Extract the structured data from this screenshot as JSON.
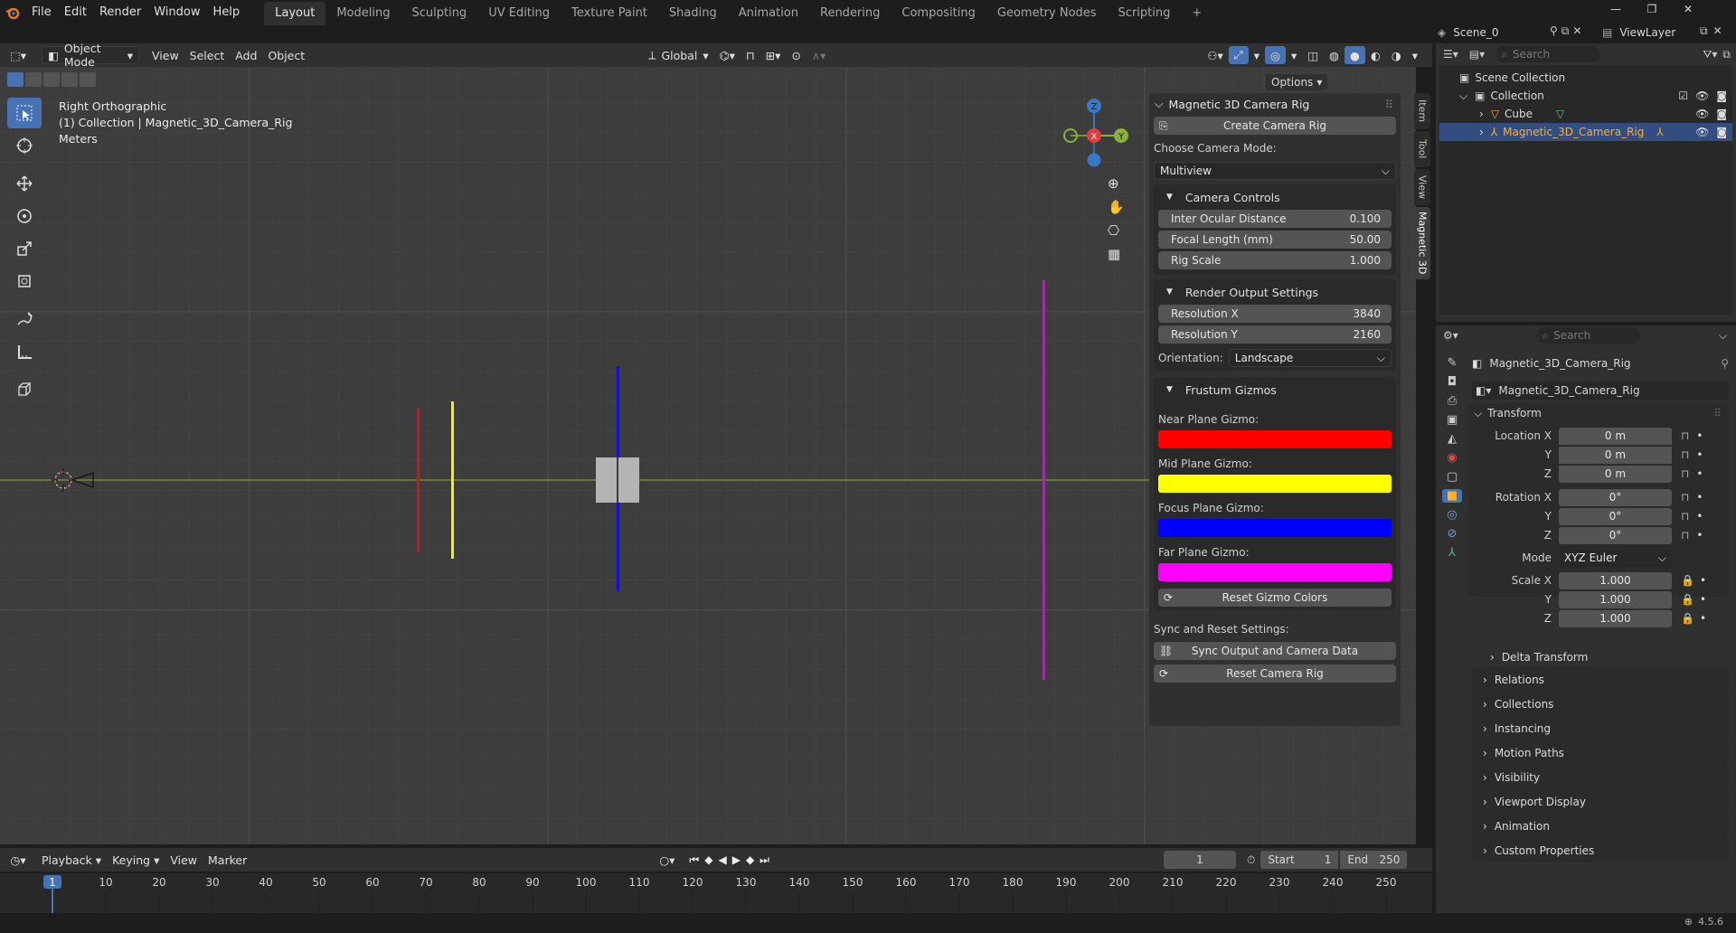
{
  "menus": [
    "File",
    "Edit",
    "Render",
    "Window",
    "Help"
  ],
  "workspaces": [
    "Layout",
    "Modeling",
    "Sculpting",
    "UV Editing",
    "Texture Paint",
    "Shading",
    "Animation",
    "Rendering",
    "Compositing",
    "Geometry Nodes",
    "Scripting"
  ],
  "active_workspace": "Layout",
  "scene": "Scene_0",
  "view_layer": "ViewLayer",
  "header": {
    "mode": "Object Mode",
    "view": "View",
    "select": "Select",
    "add": "Add",
    "object": "Object",
    "orientation": "Global",
    "options": "Options"
  },
  "viewport": {
    "view_name": "Right Orthographic",
    "collection_line": "(1) Collection | Magnetic_3D_Camera_Rig",
    "units": "Meters",
    "gizmo_axes": {
      "z": "Z",
      "x": "X",
      "y": "Y"
    },
    "plane_colors": {
      "near": "#e01010",
      "mid": "#f4f400",
      "focus": "#1010d0",
      "far": "#e000e0"
    }
  },
  "npanel": {
    "title": "Magnetic 3D Camera Rig",
    "create_button": "Create Camera Rig",
    "mode_label": "Choose Camera Mode:",
    "mode_value": "Multiview",
    "camera_controls": {
      "title": "Camera Controls",
      "fields": [
        {
          "label": "Inter Ocular Distance",
          "value": "0.100"
        },
        {
          "label": "Focal Length (mm)",
          "value": "50.00"
        },
        {
          "label": "Rig Scale",
          "value": "1.000"
        }
      ]
    },
    "render_output": {
      "title": "Render Output Settings",
      "fields": [
        {
          "label": "Resolution X",
          "value": "3840"
        },
        {
          "label": "Resolution Y",
          "value": "2160"
        }
      ],
      "orientation_label": "Orientation:",
      "orientation_value": "Landscape"
    },
    "frustum": {
      "title": "Frustum Gizmos",
      "items": [
        {
          "label": "Near Plane Gizmo:",
          "color": "#ff0000"
        },
        {
          "label": "Mid Plane Gizmo:",
          "color": "#ffff00"
        },
        {
          "label": "Focus Plane Gizmo:",
          "color": "#0000ff"
        },
        {
          "label": "Far Plane Gizmo:",
          "color": "#ff00ff"
        }
      ],
      "reset": "Reset Gizmo Colors"
    },
    "sync_label": "Sync and Reset Settings:",
    "sync_button": "Sync Output and Camera Data",
    "reset_button": "Reset Camera Rig"
  },
  "side_tabs": [
    "Item",
    "Tool",
    "View",
    "Magnetic 3D"
  ],
  "outliner": {
    "search_placeholder": "Search",
    "scene_collection": "Scene Collection",
    "collection": "Collection",
    "items": [
      "Cube",
      "Magnetic_3D_Camera_Rig"
    ]
  },
  "properties": {
    "search_placeholder": "Search",
    "object_name": "Magnetic_3D_Camera_Rig",
    "datablock": "Magnetic_3D_Camera_Rig",
    "transform_title": "Transform",
    "location": {
      "label": "Location X",
      "x": "0 m",
      "y": "0 m",
      "z": "0 m"
    },
    "rotation": {
      "label": "Rotation X",
      "x": "0°",
      "y": "0°",
      "z": "0°"
    },
    "mode_label": "Mode",
    "mode_value": "XYZ Euler",
    "scale": {
      "label": "Scale X",
      "x": "1.000",
      "y": "1.000",
      "z": "1.000"
    },
    "axis_y": "Y",
    "axis_z": "Z",
    "delta": "Delta Transform",
    "sections": [
      "Relations",
      "Collections",
      "Instancing",
      "Motion Paths",
      "Visibility",
      "Viewport Display",
      "Animation",
      "Custom Properties"
    ]
  },
  "timeline": {
    "playback": "Playback",
    "keying": "Keying",
    "view": "View",
    "marker": "Marker",
    "current_frame": "1",
    "start_label": "Start",
    "start": "1",
    "end_label": "End",
    "end": "250",
    "ticks": [
      "10",
      "20",
      "30",
      "40",
      "50",
      "60",
      "70",
      "80",
      "90",
      "100",
      "110",
      "120",
      "130",
      "140",
      "150",
      "160",
      "170",
      "180",
      "190",
      "200",
      "210",
      "220",
      "230",
      "240",
      "250"
    ],
    "cursor": "1"
  },
  "version": "4.5.6"
}
